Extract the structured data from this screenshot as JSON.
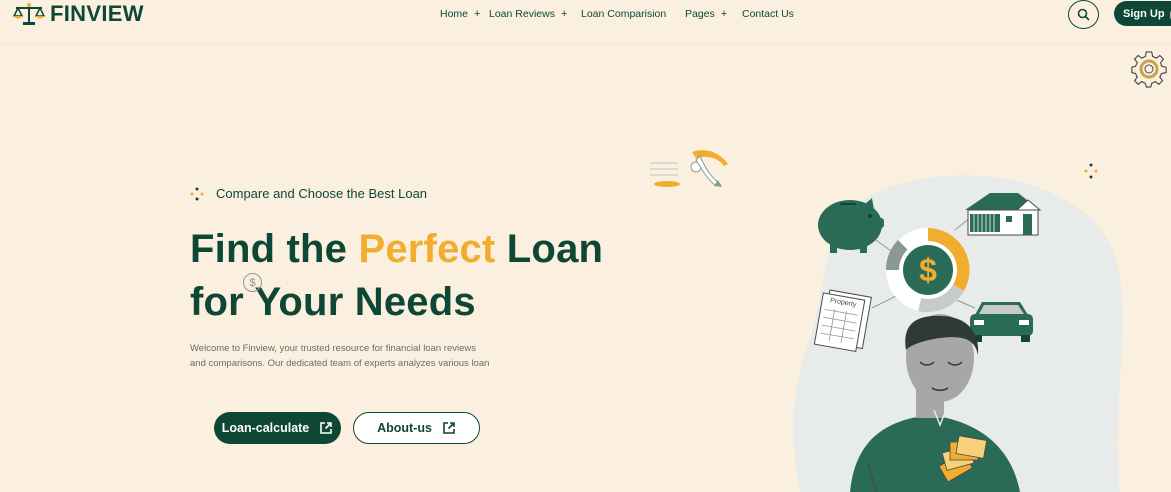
{
  "brand": {
    "name_prefix": "FIN",
    "name_suffix": "VIEW"
  },
  "nav": {
    "home": "Home",
    "loan_reviews": "Loan Reviews",
    "loan_comparison": "Loan Comparision",
    "pages": "Pages",
    "contact": "Contact Us",
    "plus": "+"
  },
  "header": {
    "signup": "Sign Up"
  },
  "hero": {
    "eyebrow": "Compare and Choose the Best Loan",
    "title_part1": "Find the ",
    "title_highlight": "Perfect",
    "title_part2": " Loan",
    "title_line2": "for Your Needs",
    "description_line1": "Welcome to Finview, your trusted resource for financial loan reviews",
    "description_line2": "and comparisons. Our dedicated team of experts analyzes various loan",
    "primary_button": "Loan-calculate",
    "secondary_button": "About-us"
  },
  "illustration": {
    "property_label": "Property",
    "dollar_sign": "$",
    "coin_symbol": "$"
  },
  "colors": {
    "brand_green": "#0f4736",
    "accent_yellow": "#f0ad2e",
    "background": "#fbf0df"
  },
  "icons": [
    "scale-logo-icon",
    "search-icon",
    "external-link-icon",
    "gear-icon",
    "dollar-coin-icon",
    "piggy-bank-icon",
    "house-icon",
    "car-icon",
    "property-doc-icon"
  ]
}
